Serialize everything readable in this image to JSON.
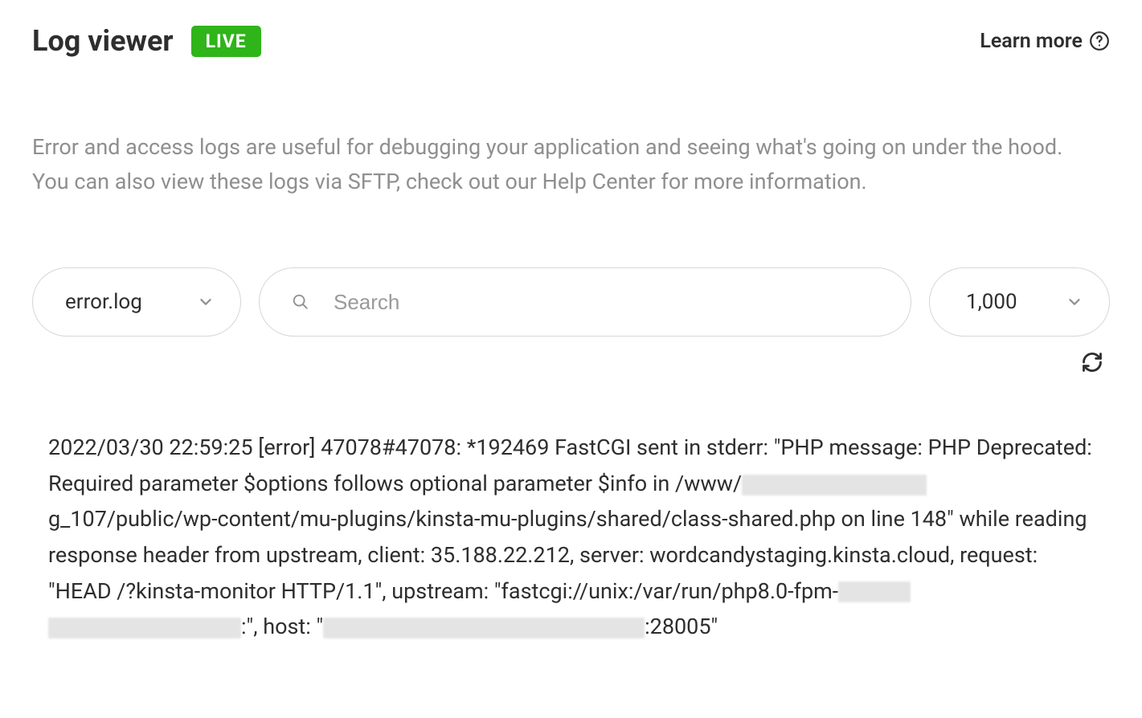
{
  "header": {
    "title": "Log viewer",
    "badge": "LIVE",
    "learn_more": "Learn more"
  },
  "description": "Error and access logs are useful for debugging your application and seeing what's going on under the hood. You can also view these logs via SFTP, check out our Help Center for more information.",
  "controls": {
    "log_file_selected": "error.log",
    "search_placeholder": "Search",
    "count_selected": "1,000"
  },
  "log": {
    "p1": "2022/03/30 22:59:25 [error] 47078#47078: *192469 FastCGI sent in stderr: \"PHP message: PHP Deprecated: Required parameter $options follows optional parameter $info in /www/",
    "p2": "g_107/public/wp-content/mu-plugins/kinsta-mu-plugins/shared/class-shared.php on line 148\" while reading response header from upstream, client: 35.188.22.212, server: wordcandystaging.kinsta.cloud, request: \"HEAD /?kinsta-monitor HTTP/1.1\", upstream: \"fastcgi://unix:/var/run/php8.0-fpm-",
    "p3": ":\", host: \"",
    "p4": ":28005\""
  }
}
